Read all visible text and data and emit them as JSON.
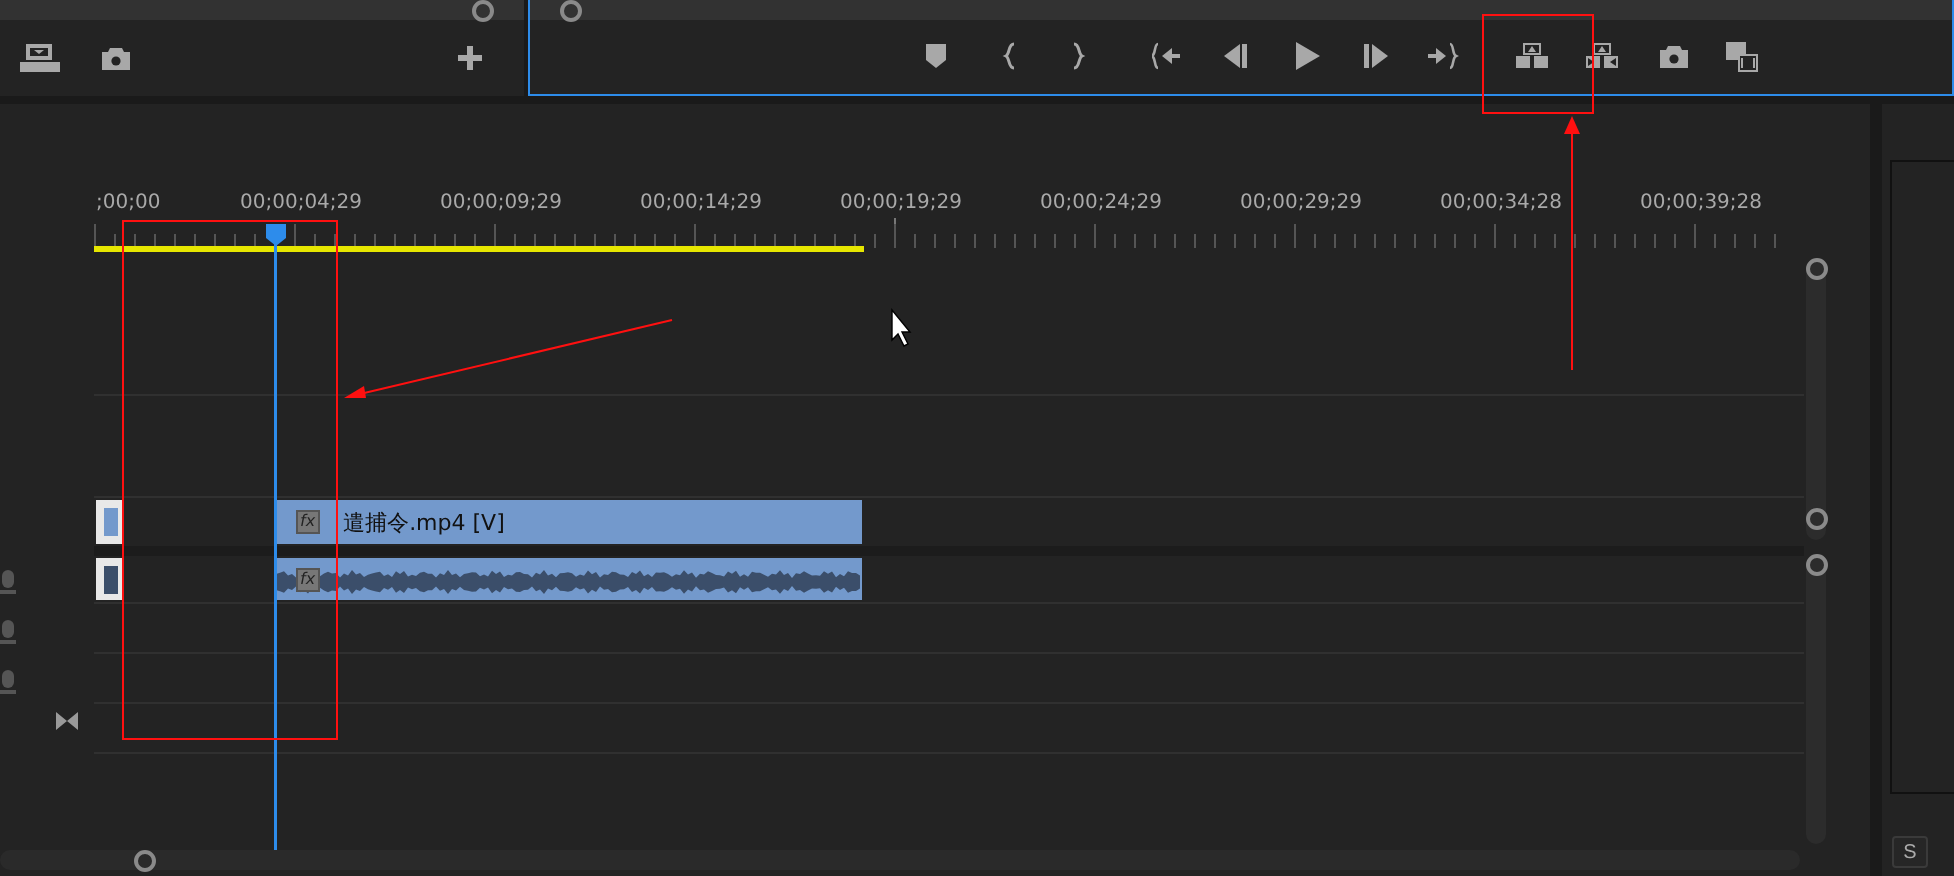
{
  "ruler": {
    "timecodes": [
      ";00;00",
      "00;00;04;29",
      "00;00;09;29",
      "00;00;14;29",
      "00;00;19;29",
      "00;00;24;29",
      "00;00;29;29",
      "00;00;34;28",
      "00;00;39;28"
    ]
  },
  "clips": [
    {
      "kind": "video",
      "label": "遣捕令.mp4 [V]",
      "badge": "fx"
    },
    {
      "kind": "audio",
      "badge": "fx"
    }
  ],
  "side_panel": {
    "button": "S"
  }
}
